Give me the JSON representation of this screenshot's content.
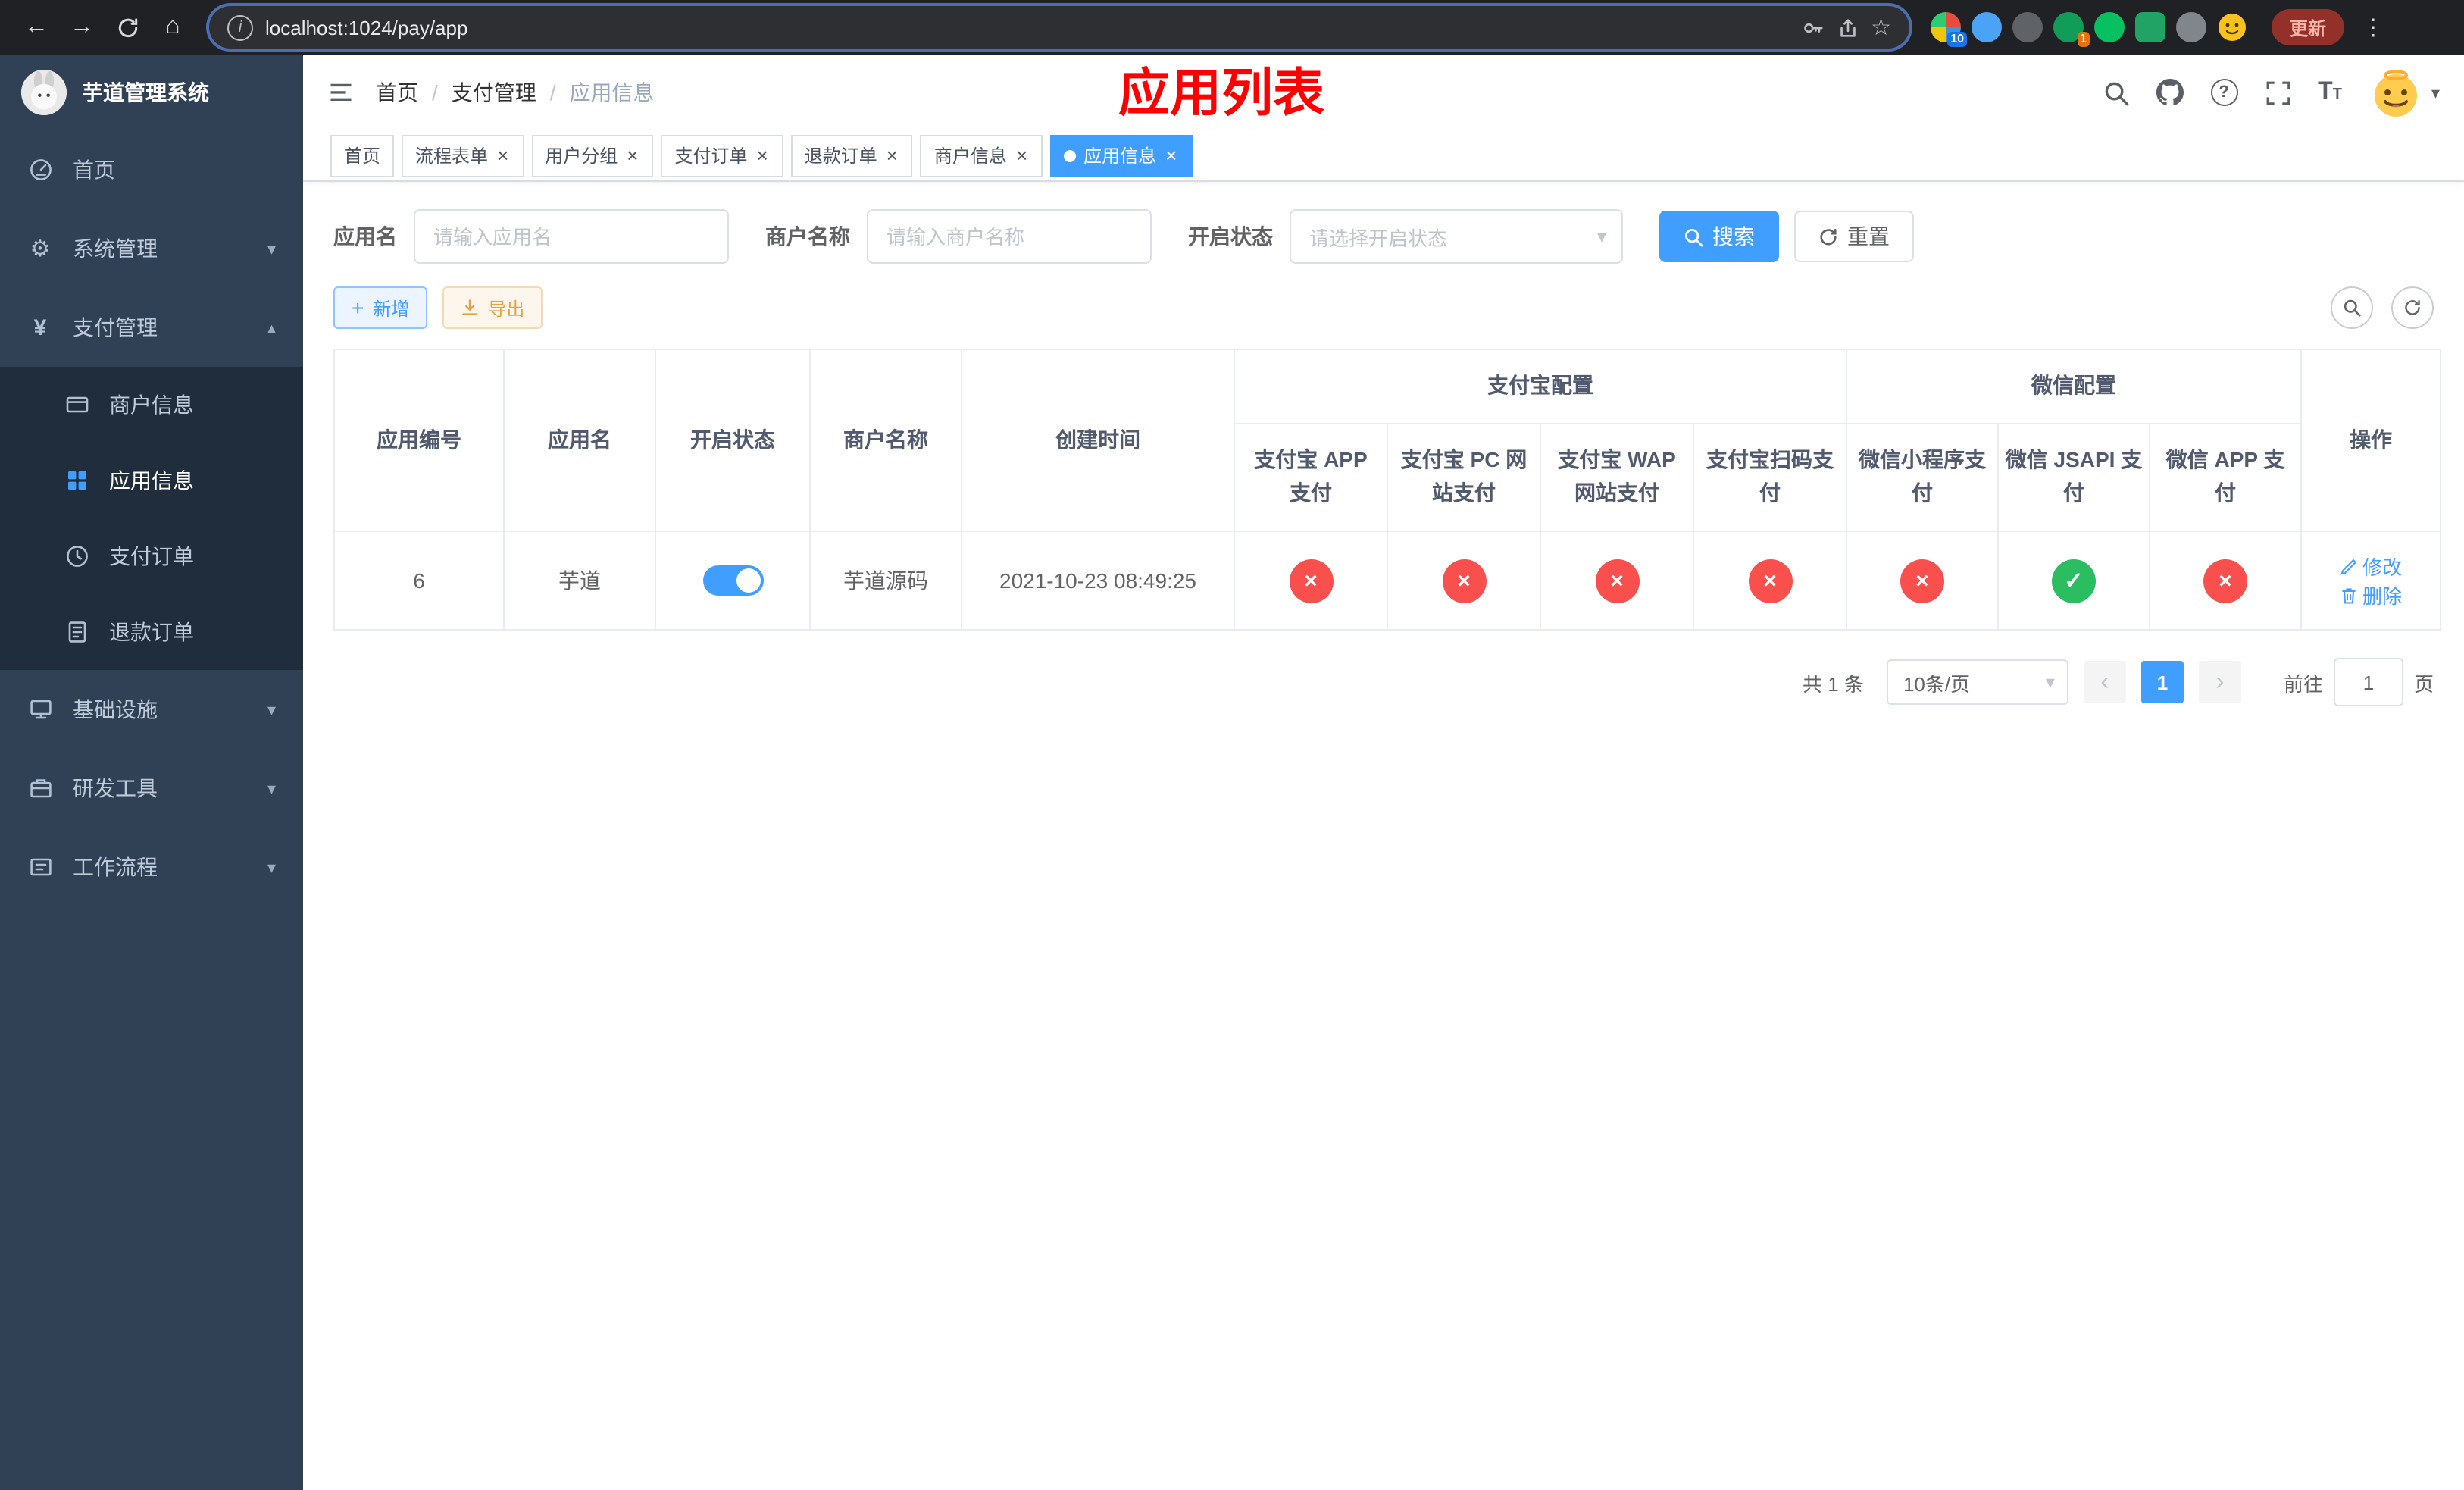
{
  "colors": {
    "accent": "#409EFF",
    "danger": "#F9504E",
    "success": "#2BBE60",
    "warning": "#E6A23C",
    "sidebar_bg": "#304156",
    "sidebar_sub_bg": "#1F2D3D",
    "annotation_red": "#FF0000",
    "browser_bar_bg": "#202124"
  },
  "browser": {
    "url": "localhost:1024/pay/app",
    "update_label": "更新",
    "ext_badge_10": "10",
    "ext_badge_1": "1"
  },
  "glyphs": {
    "back": "←",
    "forward": "→",
    "home": "⌂",
    "info": "i",
    "star": "☆",
    "menu_dots": "⋮",
    "gear": "⚙",
    "yen": "¥",
    "close": "×",
    "check": "✓",
    "cross": "×",
    "plus": "+",
    "question": "?",
    "caret_down": "▾",
    "caret_up": "▴",
    "chevron_left": "‹",
    "chevron_right": "›",
    "size_big": "T",
    "size_small": "T"
  },
  "sidebar": {
    "title": "芋道管理系统",
    "items": [
      {
        "label": "首页",
        "icon": "dashboard-icon",
        "has_children": false,
        "expanded": false
      },
      {
        "label": "系统管理",
        "icon": "gear-icon",
        "has_children": true,
        "expanded": false
      },
      {
        "label": "支付管理",
        "icon": "yen-icon",
        "has_children": true,
        "expanded": true
      },
      {
        "label": "基础设施",
        "icon": "infrastructure-icon",
        "has_children": true,
        "expanded": false
      },
      {
        "label": "研发工具",
        "icon": "dev-tools-icon",
        "has_children": true,
        "expanded": false
      },
      {
        "label": "工作流程",
        "icon": "workflow-icon",
        "has_children": true,
        "expanded": false
      }
    ],
    "pay_children": [
      {
        "label": "商户信息",
        "icon": "merchant-card-icon",
        "active": false
      },
      {
        "label": "应用信息",
        "icon": "app-grid-icon",
        "active": true
      },
      {
        "label": "支付订单",
        "icon": "pay-order-icon",
        "active": false
      },
      {
        "label": "退款订单",
        "icon": "refund-order-icon",
        "active": false
      }
    ]
  },
  "breadcrumb": {
    "items": [
      "首页",
      "支付管理",
      "应用信息"
    ],
    "separator": "/"
  },
  "annotation_title": "应用列表",
  "tabs": [
    {
      "label": "首页",
      "closable": false,
      "active": false
    },
    {
      "label": "流程表单",
      "closable": true,
      "active": false
    },
    {
      "label": "用户分组",
      "closable": true,
      "active": false
    },
    {
      "label": "支付订单",
      "closable": true,
      "active": false
    },
    {
      "label": "退款订单",
      "closable": true,
      "active": false
    },
    {
      "label": "商户信息",
      "closable": true,
      "active": false
    },
    {
      "label": "应用信息",
      "closable": true,
      "active": true
    }
  ],
  "filters": {
    "app_name_label": "应用名",
    "app_name_placeholder": "请输入应用名",
    "merchant_label": "商户名称",
    "merchant_placeholder": "请输入商户名称",
    "status_label": "开启状态",
    "status_placeholder": "请选择开启状态",
    "search_label": "搜索",
    "reset_label": "重置"
  },
  "toolbar": {
    "add_label": "新增",
    "export_label": "导出"
  },
  "table": {
    "col_app_id": "应用编号",
    "col_app_name": "应用名",
    "col_status": "开启状态",
    "col_merchant": "商户名称",
    "col_created": "创建时间",
    "group_alipay": "支付宝配置",
    "group_wechat": "微信配置",
    "col_alipay_app": "支付宝 APP 支付",
    "col_alipay_pc": "支付宝 PC 网站支付",
    "col_alipay_wap": "支付宝 WAP 网站支付",
    "col_alipay_qr": "支付宝扫码支付",
    "col_wx_mini": "微信小程序支付",
    "col_wx_jsapi": "微信 JSAPI 支付",
    "col_wx_app": "微信 APP 支付",
    "col_actions": "操作",
    "rows": [
      {
        "app_id": "6",
        "app_name": "芋道",
        "enabled": true,
        "merchant": "芋道源码",
        "created": "2021-10-23 08:49:25",
        "channels": [
          "no",
          "no",
          "no",
          "no",
          "no",
          "yes",
          "no"
        ],
        "edit_label": "修改",
        "delete_label": "删除"
      }
    ]
  },
  "pagination": {
    "total_label": "共 1 条",
    "page_size_label": "10条/页",
    "current_page": "1",
    "goto_label": "前往",
    "goto_value": "1",
    "goto_suffix": "页"
  }
}
